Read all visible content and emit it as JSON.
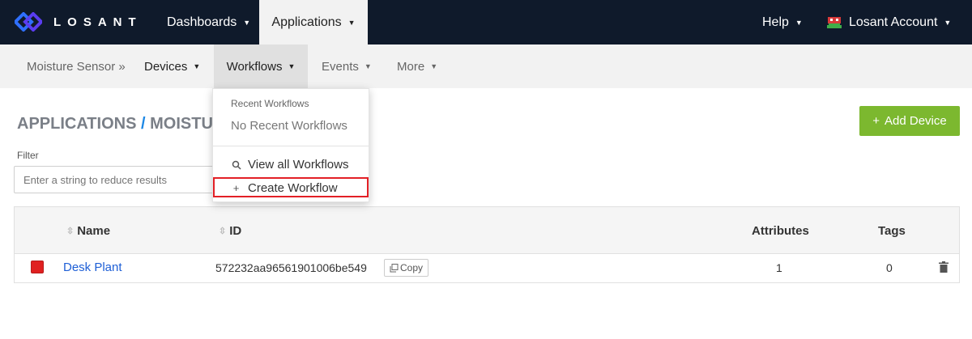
{
  "topnav": {
    "logo_text": "LOSANT",
    "dashboards": "Dashboards",
    "applications": "Applications",
    "help": "Help",
    "account": "Losant Account"
  },
  "subnav": {
    "crumb": "Moisture Sensor »",
    "devices": "Devices",
    "workflows": "Workflows",
    "events": "Events",
    "more": "More"
  },
  "page": {
    "title_part1": "APPLICATIONS",
    "title_sep": "/",
    "title_part2": "MOISTURE SE",
    "add_button": "Add Device",
    "filter_label": "Filter",
    "filter_placeholder": "Enter a string to reduce results"
  },
  "table": {
    "headers": {
      "name": "Name",
      "id": "ID",
      "attributes": "Attributes",
      "tags": "Tags"
    },
    "rows": [
      {
        "name": "Desk Plant",
        "id": "572232aa96561901006be549",
        "copy": "Copy",
        "attributes": "1",
        "tags": "0",
        "status_color": "#e02020"
      }
    ]
  },
  "dropdown": {
    "header": "Recent Workflows",
    "empty": "No Recent Workflows",
    "view_all": "View all Workflows",
    "create": "Create Workflow"
  },
  "colors": {
    "nav_bg": "#0f1a2b",
    "accent_green": "#7cb82f",
    "link_blue": "#1e5fd6",
    "highlight_red": "#e32026"
  }
}
